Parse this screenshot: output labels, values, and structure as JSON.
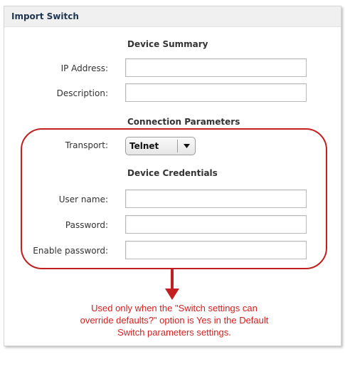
{
  "dialog": {
    "title": "Import Switch"
  },
  "device_summary": {
    "heading": "Device Summary",
    "ip_label": "IP Address:",
    "ip_value": "",
    "description_label": "Description:",
    "description_value": ""
  },
  "connection_parameters": {
    "heading": "Connection Parameters",
    "transport_label": "Transport:",
    "transport_value": "Telnet"
  },
  "device_credentials": {
    "heading": "Device Credentials",
    "username_label": "User name:",
    "username_value": "",
    "password_label": "Password:",
    "password_value": "",
    "enable_password_label": "Enable password:",
    "enable_password_value": ""
  },
  "annotation": {
    "note_line1": "Used only when the \"Switch settings can",
    "note_line2": "override defaults?\" option is Yes in the Default",
    "note_line3": "Switch parameters settings.",
    "color": "#d42020"
  },
  "icons": {
    "dropdown": "chevron-down-icon",
    "callout": "arrow-down-icon"
  },
  "colors": {
    "title_text": "#1f3550",
    "title_bar": "#f0f0f0",
    "highlight": "#c22020"
  }
}
